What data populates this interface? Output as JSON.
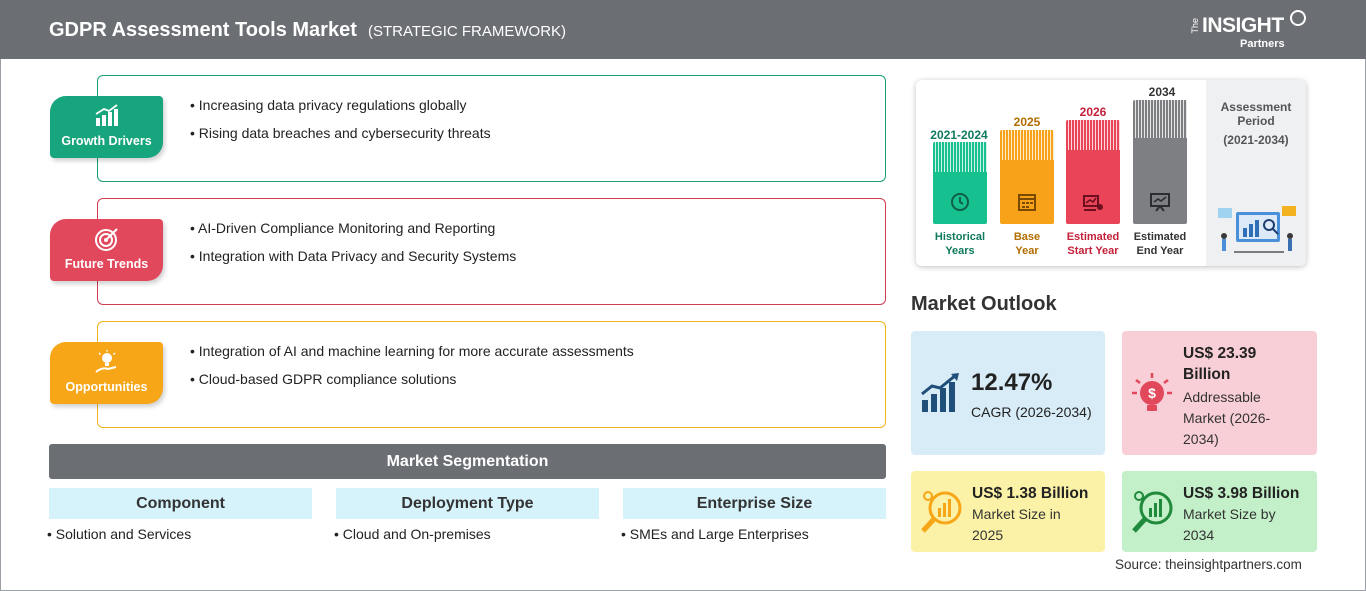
{
  "header": {
    "title": "GDPR Assessment Tools Market",
    "subtitle": "(STRATEGIC FRAMEWORK)",
    "logo": {
      "the": "The",
      "insight": "INSIGHT",
      "partners": "Partners"
    }
  },
  "framework": {
    "growth_drivers": {
      "label": "Growth Drivers",
      "color": "#17a57d",
      "icon": "bar-growth-icon",
      "bullets": [
        "• Increasing data privacy regulations globally",
        "• Rising data breaches and cybersecurity threats"
      ]
    },
    "future_trends": {
      "label": "Future Trends",
      "color": "#e2485c",
      "icon": "target-icon",
      "bullets": [
        "• AI-Driven Compliance Monitoring and Reporting",
        "• Integration with Data Privacy and Security Systems"
      ]
    },
    "opportunities": {
      "label": "Opportunities",
      "color": "#f6a616",
      "icon": "lightbulb-hand-icon",
      "bullets": [
        "• Integration of AI and machine learning for more accurate assessments",
        "• Cloud-based GDPR compliance solutions"
      ]
    }
  },
  "segmentation": {
    "title": "Market Segmentation",
    "columns": [
      {
        "heading": "Component",
        "item": "• Solution and Services"
      },
      {
        "heading": "Deployment Type",
        "item": "• Cloud and On-premises"
      },
      {
        "heading": "Enterprise Size",
        "item": "• SMEs and Large Enterprises"
      }
    ]
  },
  "timeline": {
    "bars": [
      {
        "year": "2021-2024",
        "label_line1": "Historical",
        "label_line2": "Years",
        "color": "#17c08f",
        "icon": "history-icon"
      },
      {
        "year": "2025",
        "label_line1": "Base",
        "label_line2": "Year",
        "color": "#f8a21a",
        "icon": "calendar-icon"
      },
      {
        "year": "2026",
        "label_line1": "Estimated",
        "label_line2": "Start Year",
        "color": "#ea4459",
        "icon": "start-chart-icon"
      },
      {
        "year": "2034",
        "label_line1": "Estimated",
        "label_line2": "End Year",
        "color": "#7d7f83",
        "icon": "presentation-icon"
      }
    ],
    "side_title_line1": "Assessment",
    "side_title_line2": "Period",
    "side_range": "(2021-2034)"
  },
  "outlook": {
    "title": "Market Outlook",
    "cagr": {
      "value": "12.47%",
      "label": "CAGR (2026-2034)"
    },
    "addressable": {
      "value_line1": "US$ 23.39",
      "value_line2": "Billion",
      "label_line1": "Addressable",
      "label_line2": "Market (2026-",
      "label_line3": "2034)"
    },
    "size_2025": {
      "value": "US$ 1.38 Billion",
      "label_line1": "Market Size in",
      "label_line2": "2025"
    },
    "size_2034": {
      "value": "US$ 3.98 Billion",
      "label_line1": "Market Size by",
      "label_line2": "2034"
    }
  },
  "source": "Source: theinsightpartners.com"
}
